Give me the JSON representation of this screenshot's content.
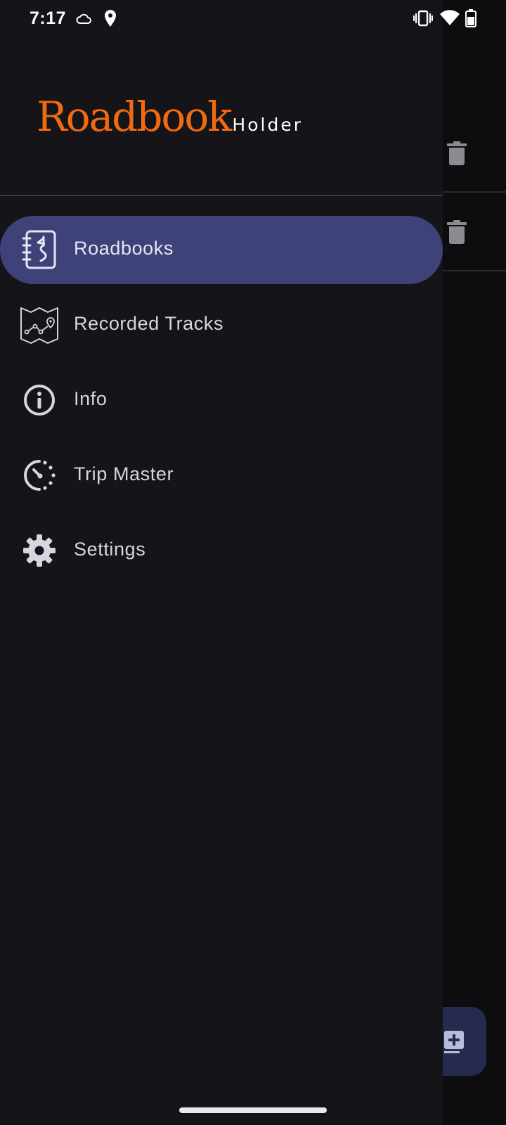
{
  "status_bar": {
    "time": "7:17",
    "left_icons": [
      "cloud-icon",
      "location-pin-icon"
    ],
    "right_icons": [
      "vibrate-icon",
      "wifi-icon",
      "battery-icon"
    ]
  },
  "drawer": {
    "logo": {
      "main": "Roadbook",
      "sub": "Holder",
      "main_color": "#f26a10",
      "sub_color": "#ffffff"
    },
    "items": [
      {
        "label": "Roadbooks",
        "icon": "roadbook-icon",
        "active": true
      },
      {
        "label": "Recorded Tracks",
        "icon": "map-track-icon",
        "active": false
      },
      {
        "label": "Info",
        "icon": "info-icon",
        "active": false
      },
      {
        "label": "Trip Master",
        "icon": "trip-master-icon",
        "active": false
      },
      {
        "label": "Settings",
        "icon": "gear-icon",
        "active": false
      }
    ],
    "active_color": "#3e4279",
    "background_color": "#141419"
  },
  "background_app": {
    "list_item_actions": [
      "trash-icon",
      "trash-icon"
    ],
    "fab_icon": "add-document-icon"
  }
}
